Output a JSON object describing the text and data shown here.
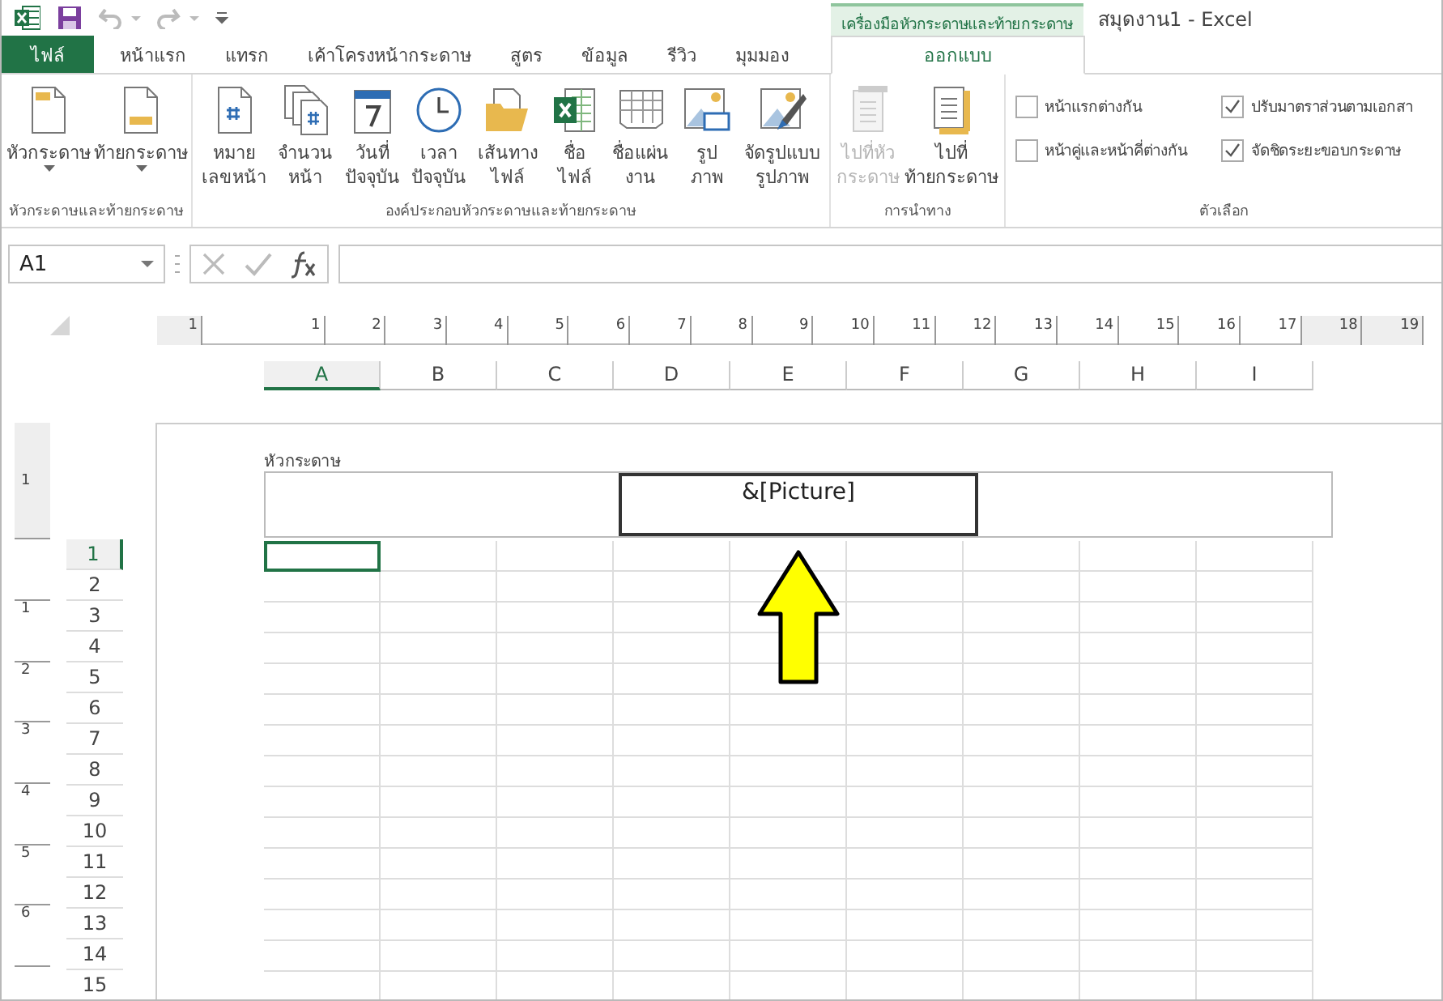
{
  "title_bar": {
    "context_tab": "เครื่องมือหัวกระดาษและท้ายกระดาษ",
    "title": "สมุดงาน1 - Excel"
  },
  "tabs": [
    {
      "label": "ไฟล์",
      "kind": "file",
      "selected": false
    },
    {
      "label": "หน้าแรก",
      "kind": "tab",
      "selected": false
    },
    {
      "label": "แทรก",
      "kind": "tab",
      "selected": false
    },
    {
      "label": "เค้าโครงหน้ากระดาษ",
      "kind": "tab",
      "selected": false
    },
    {
      "label": "สูตร",
      "kind": "tab",
      "selected": false
    },
    {
      "label": "ข้อมูล",
      "kind": "tab",
      "selected": false
    },
    {
      "label": "รีวิว",
      "kind": "tab",
      "selected": false
    },
    {
      "label": "มุมมอง",
      "kind": "tab",
      "selected": false
    },
    {
      "label": "ออกแบบ",
      "kind": "context",
      "selected": true
    }
  ],
  "ribbon": {
    "groups": [
      {
        "label": "หัวกระดาษและท้ายกระดาษ",
        "buttons": [
          {
            "lines": [
              "หัวกระดาษ"
            ],
            "kind": "header",
            "dropdown": true,
            "disabled": false
          },
          {
            "lines": [
              "ท้ายกระดาษ"
            ],
            "kind": "footer",
            "dropdown": true,
            "disabled": false
          }
        ]
      },
      {
        "label": "องค์ประกอบหัวกระดาษและท้ายกระดาษ",
        "buttons": [
          {
            "lines": [
              "หมาย",
              "เลขหน้า"
            ],
            "kind": "page_number",
            "dropdown": false,
            "disabled": false
          },
          {
            "lines": [
              "จำนวน",
              "หน้า"
            ],
            "kind": "page_count",
            "dropdown": false,
            "disabled": false
          },
          {
            "lines": [
              "วันที่",
              "ปัจจุบัน"
            ],
            "kind": "date",
            "dropdown": false,
            "disabled": false
          },
          {
            "lines": [
              "เวลา",
              "ปัจจุบัน"
            ],
            "kind": "time",
            "dropdown": false,
            "disabled": false
          },
          {
            "lines": [
              "เส้นทาง",
              "ไฟล์"
            ],
            "kind": "file_path",
            "dropdown": false,
            "disabled": false
          },
          {
            "lines": [
              "ชื่อ",
              "ไฟล์"
            ],
            "kind": "file_name",
            "dropdown": false,
            "disabled": false
          },
          {
            "lines": [
              "ชื่อแผ่น",
              "งาน"
            ],
            "kind": "sheet_name",
            "dropdown": false,
            "disabled": false
          },
          {
            "lines": [
              "รูป",
              "ภาพ"
            ],
            "kind": "picture",
            "dropdown": false,
            "disabled": false
          },
          {
            "lines": [
              "จัดรูปแบบ",
              "รูปภาพ"
            ],
            "kind": "format_picture",
            "dropdown": false,
            "disabled": false
          }
        ]
      },
      {
        "label": "การนำทาง",
        "buttons": [
          {
            "lines": [
              "ไปที่หัว",
              "กระดาษ"
            ],
            "kind": "goto_header",
            "dropdown": false,
            "disabled": true
          },
          {
            "lines": [
              "ไปที่",
              "ท้ายกระดาษ"
            ],
            "kind": "goto_footer",
            "dropdown": false,
            "disabled": false
          }
        ]
      },
      {
        "label": "ตัวเลือก",
        "checkboxes": [
          {
            "label": "หน้าแรกต่างกัน",
            "checked": false
          },
          {
            "label": "ปรับมาตราส่วนตามเอกสา",
            "checked": true
          },
          {
            "label": "หน้าคู่และหน้าคี่ต่างกัน",
            "checked": false
          },
          {
            "label": "จัดชิดระยะขอบกระดาษ",
            "checked": true
          }
        ]
      }
    ]
  },
  "formula_bar": {
    "name_box": "A1"
  },
  "ruler": [
    {
      "label": "1",
      "margin": true
    },
    {
      "label": "1",
      "margin": false
    },
    {
      "label": "2",
      "margin": false
    },
    {
      "label": "3",
      "margin": false
    },
    {
      "label": "4",
      "margin": false
    },
    {
      "label": "5",
      "margin": false
    },
    {
      "label": "6",
      "margin": false
    },
    {
      "label": "7",
      "margin": false
    },
    {
      "label": "8",
      "margin": false
    },
    {
      "label": "9",
      "margin": false
    },
    {
      "label": "10",
      "margin": false
    },
    {
      "label": "11",
      "margin": false
    },
    {
      "label": "12",
      "margin": false
    },
    {
      "label": "13",
      "margin": false
    },
    {
      "label": "14",
      "margin": false
    },
    {
      "label": "15",
      "margin": false
    },
    {
      "label": "16",
      "margin": false
    },
    {
      "label": "17",
      "margin": false
    },
    {
      "label": "18",
      "margin": true
    },
    {
      "label": "19",
      "margin": true
    }
  ],
  "vertical_ruler": [
    {
      "label": "1",
      "margin": true
    },
    {
      "label": "1",
      "margin": false
    },
    {
      "label": "2",
      "margin": false
    },
    {
      "label": "3",
      "margin": false
    },
    {
      "label": "4",
      "margin": false
    },
    {
      "label": "5",
      "margin": false
    },
    {
      "label": "6",
      "margin": false
    }
  ],
  "columns": [
    {
      "label": "A",
      "selected": true
    },
    {
      "label": "B",
      "selected": false
    },
    {
      "label": "C",
      "selected": false
    },
    {
      "label": "D",
      "selected": false
    },
    {
      "label": "E",
      "selected": false
    },
    {
      "label": "F",
      "selected": false
    },
    {
      "label": "G",
      "selected": false
    },
    {
      "label": "H",
      "selected": false
    },
    {
      "label": "I",
      "selected": false
    }
  ],
  "page": {
    "header_label": "หัวกระดาษ",
    "header_sections": [
      {
        "selected": false
      },
      {
        "text": "&[Picture]",
        "selected": true
      },
      {
        "selected": false
      }
    ]
  },
  "rows": [
    {
      "label": "1",
      "selected": true
    },
    {
      "label": "2",
      "selected": false
    },
    {
      "label": "3",
      "selected": false
    },
    {
      "label": "4",
      "selected": false
    },
    {
      "label": "5",
      "selected": false
    },
    {
      "label": "6",
      "selected": false
    },
    {
      "label": "7",
      "selected": false
    },
    {
      "label": "8",
      "selected": false
    },
    {
      "label": "9",
      "selected": false
    },
    {
      "label": "10",
      "selected": false
    },
    {
      "label": "11",
      "selected": false
    },
    {
      "label": "12",
      "selected": false
    },
    {
      "label": "13",
      "selected": false
    },
    {
      "label": "14",
      "selected": false
    },
    {
      "label": "15",
      "selected": false
    }
  ]
}
